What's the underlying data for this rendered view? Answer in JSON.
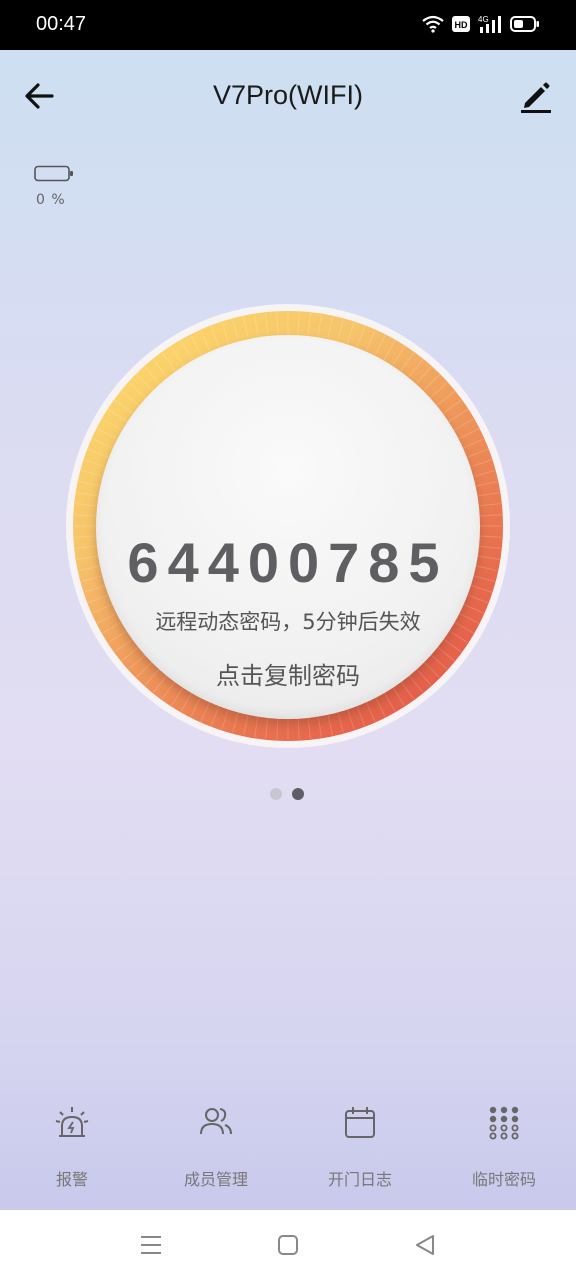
{
  "status_bar": {
    "time": "00:47"
  },
  "header": {
    "title": "V7Pro(WIFI)"
  },
  "battery": {
    "percent_label": "0 %",
    "level": 0
  },
  "password": {
    "code": "64400785",
    "description": "远程动态密码，5分钟后失效",
    "copy_label": "点击复制密码"
  },
  "pager": {
    "count": 2,
    "active": 2
  },
  "bottom_nav": {
    "items": [
      {
        "label": "报警",
        "icon": "alarm-light-icon"
      },
      {
        "label": "成员管理",
        "icon": "members-icon"
      },
      {
        "label": "开门日志",
        "icon": "calendar-icon"
      },
      {
        "label": "临时密码",
        "icon": "keypad-icon"
      }
    ]
  },
  "colors": {
    "dial_start": "#f9d66a",
    "dial_mid": "#ef9a5b",
    "dial_end": "#e6564a",
    "text_dark": "#5f5f63"
  }
}
